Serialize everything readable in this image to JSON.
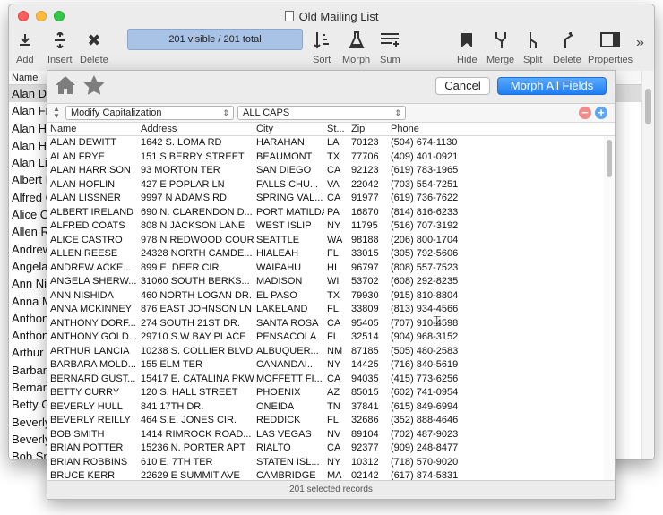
{
  "window": {
    "title": "Old Mailing List"
  },
  "toolbar": {
    "add": "Add",
    "insert": "Insert",
    "delete": "Delete",
    "visible_count": "201 visible / 201 total",
    "sort": "Sort",
    "morph": "Morph",
    "sum": "Sum",
    "hide": "Hide",
    "merge": "Merge",
    "split": "Split",
    "delete2": "Delete",
    "properties": "Properties",
    "more": "»"
  },
  "main": {
    "header": "Name",
    "rows": [
      "Alan De",
      "Alan Fr",
      "Alan Ha",
      "Alan Ho",
      "Alan Lis",
      "Albert I",
      "Alfred C",
      "Alice C",
      "Allen R",
      "Andrew",
      "Angela",
      "Ann Nis",
      "Anna M",
      "Anthon",
      "Anthon",
      "Arthur",
      "Barbara",
      "Bernard",
      "Betty C",
      "Beverly",
      "Beverly",
      "Bob Sn"
    ]
  },
  "sheet": {
    "cancel": "Cancel",
    "morph_all": "Morph All Fields",
    "operation": "Modify Capitalization",
    "option": "ALL CAPS",
    "columns": {
      "name": "Name",
      "address": "Address",
      "city": "City",
      "state": "St...",
      "zip": "Zip",
      "phone": "Phone"
    },
    "records": [
      [
        "ALAN DEWITT",
        "1642 S. LOMA RD",
        "HARAHAN",
        "LA",
        "70123",
        "(504) 674-1130"
      ],
      [
        "ALAN FRYE",
        "151 S BERRY STREET",
        "BEAUMONT",
        "TX",
        "77706",
        "(409) 401-0921"
      ],
      [
        "ALAN HARRISON",
        "93 MORTON TER",
        "SAN DIEGO",
        "CA",
        "92123",
        "(619) 783-1965"
      ],
      [
        "ALAN HOFLIN",
        "427 E POPLAR LN",
        "FALLS CHU...",
        "VA",
        "22042",
        "(703) 554-7251"
      ],
      [
        "ALAN LISSNER",
        "9997 N ADAMS RD",
        "SPRING VAL...",
        "CA",
        "91977",
        "(619) 736-7622"
      ],
      [
        "ALBERT IRELAND",
        "690 N. CLARENDON D...",
        "PORT MATILDA",
        "PA",
        "16870",
        "(814) 816-6233"
      ],
      [
        "ALFRED COATS",
        "808 N JACKSON LANE",
        "WEST ISLIP",
        "NY",
        "11795",
        "(516) 707-3192"
      ],
      [
        "ALICE CASTRO",
        "978 N REDWOOD COURT",
        "SEATTLE",
        "WA",
        "98188",
        "(206) 800-1704"
      ],
      [
        "ALLEN REESE",
        "24328 NORTH CAMDE...",
        "HIALEAH",
        "FL",
        "33015",
        "(305) 792-5606"
      ],
      [
        "ANDREW ACKE...",
        "899 E. DEER CIR",
        "WAIPAHU",
        "HI",
        "96797",
        "(808) 557-7523"
      ],
      [
        "ANGELA SHERW...",
        "31060 SOUTH BERKS...",
        "MADISON",
        "WI",
        "53702",
        "(608) 292-8235"
      ],
      [
        "ANN NISHIDA",
        "460 NORTH LOGAN DR.",
        "EL PASO",
        "TX",
        "79930",
        "(915) 810-8804"
      ],
      [
        "ANNA MCKINNEY",
        "876 EAST JOHNSON LN",
        "LAKELAND",
        "FL",
        "33809",
        "(813) 934-4566"
      ],
      [
        "ANTHONY DORF...",
        "274 SOUTH 21ST DR.",
        "SANTA ROSA",
        "CA",
        "95405",
        "(707) 910-4598"
      ],
      [
        "ANTHONY GOLD...",
        "29710 S.W BAY PLACE",
        "PENSACOLA",
        "FL",
        "32514",
        "(904) 968-3152"
      ],
      [
        "ARTHUR LANCIA",
        "10238 S. COLLIER BLVD.",
        "ALBUQUER...",
        "NM",
        "87185",
        "(505) 480-2583"
      ],
      [
        "BARBARA MOLD...",
        "155 ELM TER",
        "CANANDAI...",
        "NY",
        "14425",
        "(716) 840-5619"
      ],
      [
        "BERNARD GUST...",
        "15417 E. CATALINA PKWY",
        "MOFFETT FI...",
        "CA",
        "94035",
        "(415) 773-6256"
      ],
      [
        "BETTY CURRY",
        "120 S. HALL STREET",
        "PHOENIX",
        "AZ",
        "85015",
        "(602) 741-0954"
      ],
      [
        "BEVERLY HULL",
        "841 17TH DR.",
        "ONEIDA",
        "TN",
        "37841",
        "(615) 849-6994"
      ],
      [
        "BEVERLY REILLY",
        "464 S.E. JONES CIR.",
        "REDDICK",
        "FL",
        "32686",
        "(352) 888-4646"
      ],
      [
        "BOB SMITH",
        "1414 RIMROCK ROAD...",
        "LAS VEGAS",
        "NV",
        "89104",
        "(702) 487-9023"
      ],
      [
        "BRIAN POTTER",
        "15236 N. PORTER APT",
        "RIALTO",
        "CA",
        "92377",
        "(909) 248-8477"
      ],
      [
        "BRIAN ROBBINS",
        "610 E. 7TH TER",
        "STATEN ISL...",
        "NY",
        "10312",
        "(718) 570-9020"
      ],
      [
        "BRUCE KERR",
        "22629 E SUMMIT AVE",
        "CAMBRIDGE",
        "MA",
        "02142",
        "(617) 874-5831"
      ]
    ],
    "status": "201 selected records"
  }
}
